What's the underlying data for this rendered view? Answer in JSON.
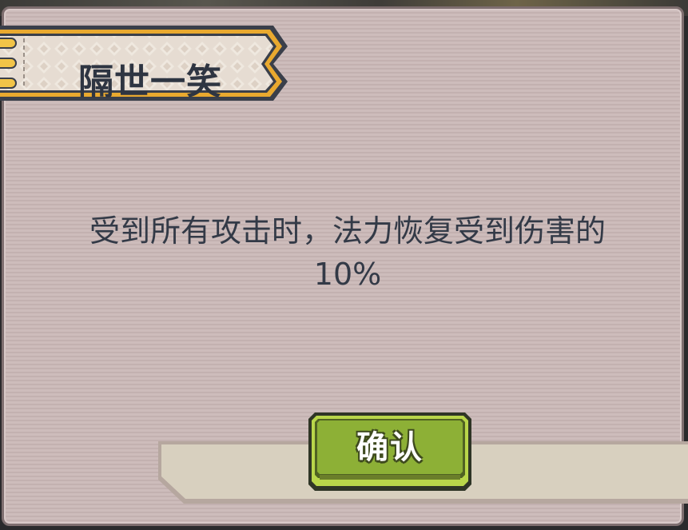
{
  "dialog": {
    "title": "隔世一笑",
    "message_line1": "受到所有攻击时，法力恢复受到伤害的",
    "message_line2": "10%",
    "confirm_label": "确认"
  },
  "colors": {
    "panel": "#cbb9b8",
    "ribbon_border": "#e9a92f",
    "text": "#333a47",
    "button_green": "#8fb437"
  }
}
